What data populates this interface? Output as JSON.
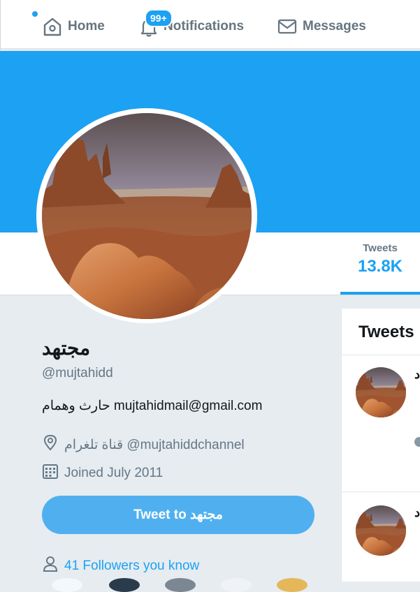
{
  "nav": {
    "home": "Home",
    "notifications": "Notifications",
    "notifications_badge": "99+",
    "messages": "Messages"
  },
  "profile": {
    "tweets_label": "Tweets",
    "tweets_count": "13.8K",
    "name": "مجتهد",
    "handle": "@mujtahidd",
    "bio": "حارث وهمام mujtahidmail@gmail.com",
    "location": "قناة تلغرام @mujtahiddchannel",
    "joined": "Joined July 2011",
    "tweet_to_button": "Tweet to مجتهد",
    "followers_you_know": "41 Followers you know"
  },
  "tweets_panel": {
    "title": "Tweets",
    "items": [
      {
        "author": "د"
      },
      {
        "author": "د"
      }
    ]
  },
  "icons": {
    "home": "home-icon",
    "notifications": "bell-icon",
    "messages": "envelope-icon",
    "location": "location-pin-icon",
    "joined": "calendar-icon",
    "followers": "person-icon"
  },
  "colors": {
    "accent": "#1da1f2",
    "button": "#50b0ef",
    "background": "#e6ecf0",
    "muted_text": "#657786"
  }
}
